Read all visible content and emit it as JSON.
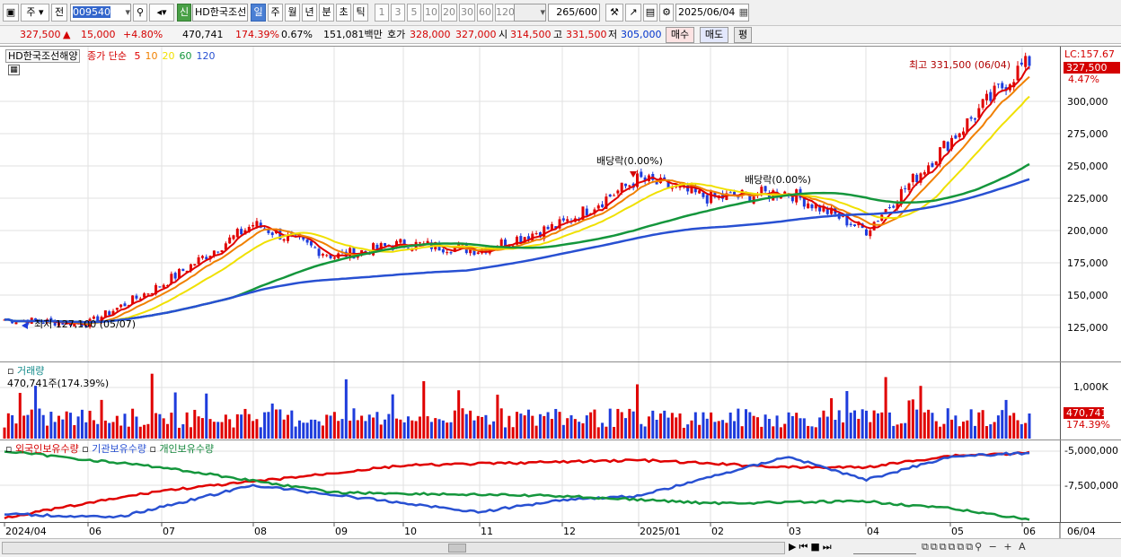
{
  "toolbar": {
    "period_type": "주",
    "prev_label": "전",
    "code": "009540",
    "mode_badge": "신",
    "stock_name": "HD한국조선",
    "periods": [
      "일",
      "주",
      "월",
      "년",
      "분",
      "초",
      "틱"
    ],
    "active_period": "일",
    "intervals": [
      "1",
      "3",
      "5",
      "10",
      "20",
      "30",
      "60",
      "120"
    ],
    "count": "265",
    "count_total": "/600",
    "date": "2025/06/04"
  },
  "infobar": {
    "price": "327,500",
    "change_arrow": "▲",
    "change": "15,000",
    "change_pct": "+4.80%",
    "volume": "470,741",
    "volume_ratio": "174.39%",
    "turnover": "0.67%",
    "amount": "151,081백만",
    "ask_label": "호가",
    "ask": "328,000",
    "bid": "327,000",
    "open_label": "시",
    "open": "314,500",
    "high_label": "고",
    "high": "331,500",
    "low_label": "저",
    "low": "305,000",
    "buy_label": "매수",
    "sell_label": "매도",
    "avg_label": "평"
  },
  "price_panel": {
    "name": "HD한국조선해양",
    "legend_prefix": "종가 단순",
    "ma_labels": [
      "5",
      "10",
      "20",
      "60",
      "120"
    ],
    "ma_colors": [
      "#e00000",
      "#f08000",
      "#f0e000",
      "#14963c",
      "#2850d2"
    ],
    "lc": "LC:157.67",
    "last_price": "327,500",
    "last_pct": "4.47%",
    "high_annotation": "최고 331,500 (06/04)",
    "low_annotation": "최저 127,100 (05/07)",
    "dividend_1": "배당락(0.00%)",
    "dividend_2": "배당락(0.00%)",
    "yticks": [
      "300,000",
      "275,000",
      "250,000",
      "225,000",
      "200,000",
      "175,000",
      "150,000",
      "125,000"
    ]
  },
  "volume_panel": {
    "title": "거래량",
    "value": "470,741주(174.39%)",
    "ytick": "1,000K",
    "last_value": "470,741",
    "last_pct": "174.39%"
  },
  "holder_panel": {
    "foreign": "외국인보유수량",
    "inst": "기관보유수량",
    "retail": "개인보유수량",
    "yticks": [
      "-5,000,000",
      "-7,500,000"
    ]
  },
  "xaxis": {
    "labels": [
      "2024/04",
      "06",
      "07",
      "08",
      "09",
      "10",
      "11",
      "12",
      "2025/01",
      "02",
      "03",
      "04",
      "05",
      "06"
    ],
    "right_label": "06/04"
  },
  "chart_data": {
    "type": "line",
    "price_series": {
      "dates": [
        "2024/04",
        "06",
        "07",
        "08",
        "09",
        "10",
        "11",
        "12",
        "2025/01",
        "02",
        "03",
        "04",
        "05",
        "06"
      ],
      "close": [
        131000,
        128000,
        158000,
        205000,
        180000,
        190000,
        185000,
        205000,
        240000,
        225000,
        230000,
        200000,
        270000,
        327500
      ]
    },
    "high": 331500,
    "low": 127100,
    "volume_last": 470741
  }
}
